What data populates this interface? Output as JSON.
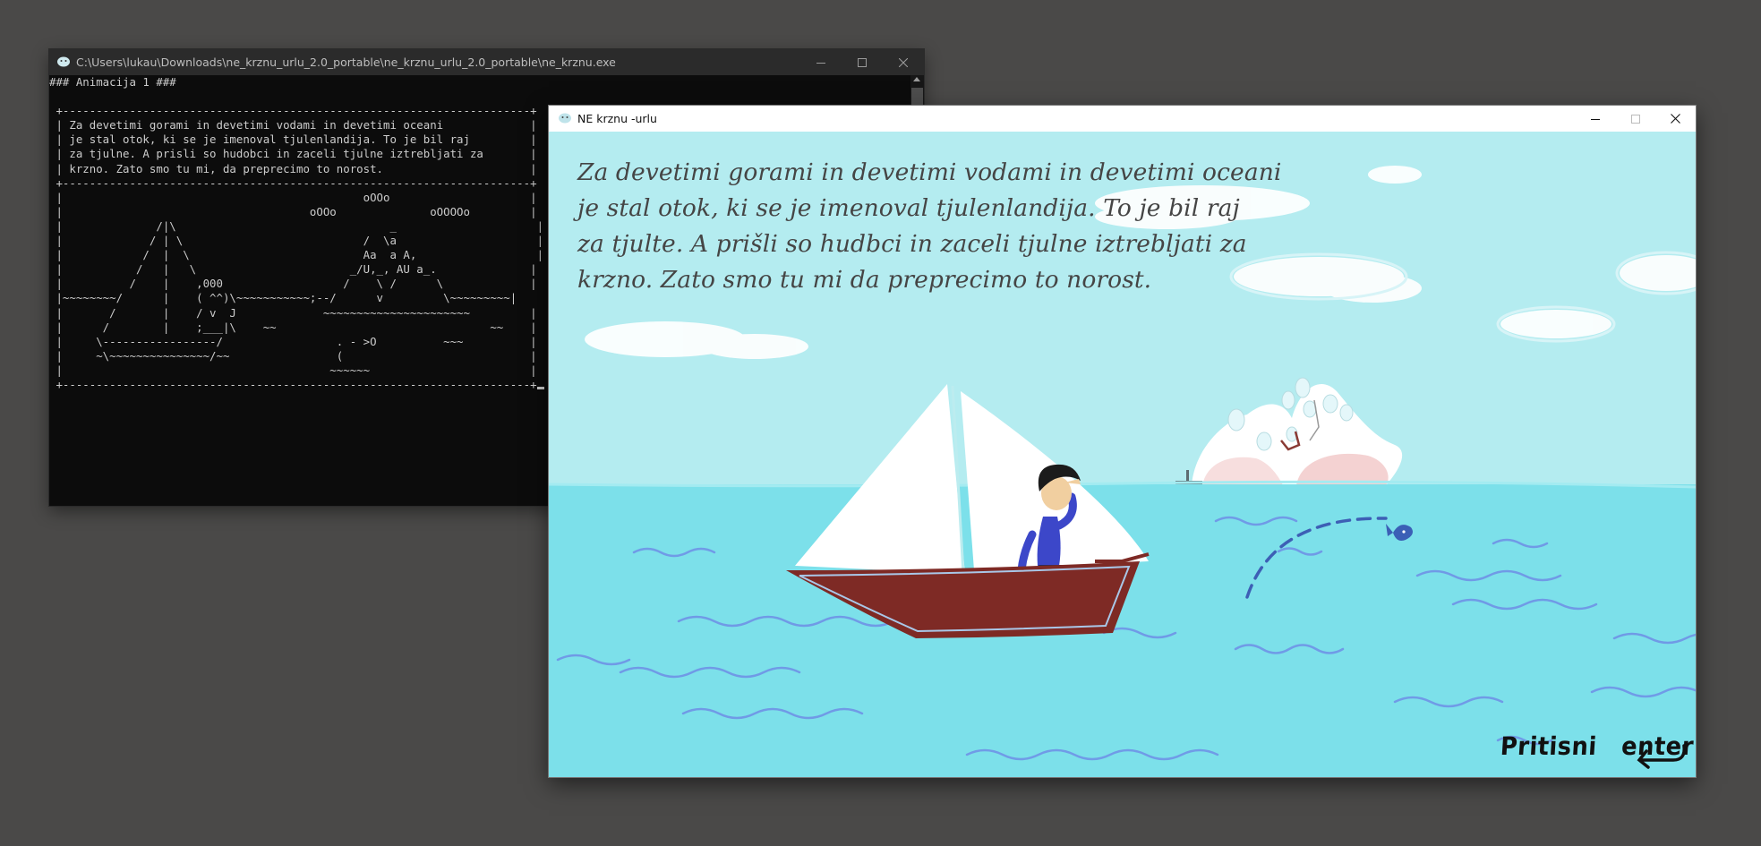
{
  "console": {
    "title": "C:\\Users\\lukau\\Downloads\\ne_krznu_urlu_2.0_portable\\ne_krznu_urlu_2.0_portable\\ne_krznu.exe",
    "lines": [
      "### Animacija 1 ###",
      "",
      " +----------------------------------------------------------------------+",
      " | Za devetimi gorami in devetimi vodami in devetimi oceani             |",
      " | je stal otok, ki se je imenoval tjulenlandija. To je bil raj         |",
      " | za tjulne. A prisli so hudobci in zaceli tjulne iztrebljati za       |",
      " | krzno. Zato smo tu mi, da preprecimo to norost.                      |",
      " +----------------------------------------------------------------------+",
      " |                                             oOOo                     |",
      " |                                     oOOo              oOOOOo         |",
      " |              /|\\                                _                     |",
      " |             / | \\                           /  \\a                     |",
      " |            /  |  \\                          Aa  a A,                  |",
      " |           /   |   \\                       _/U,_, AU a_.              |",
      " |          /    |    ,000                  /    \\ /      \\             |",
      " |~~~~~~~~/      |    ( ^^)\\~~~~~~~~~~~;--/      v         \\~~~~~~~~~|",
      " |       /       |    / v  J             ~~~~~~~~~~~~~~~~~~~~~~         |",
      " |      /        |    ;___|\\    ~~                                ~~    |",
      " |     \\-----------------/                 . - >O          ~~~          |",
      " |     ~\\~~~~~~~~~~~~~~~/~~                (                            |",
      " |                                        ~~~~~~                        |",
      " +----------------------------------------------------------------------+"
    ]
  },
  "game": {
    "title": "NE krznu -urlu",
    "story_lines": [
      "Za devetimi gorami in devetimi vodami in devetimi oceani",
      "je stal otok, ki se je imenoval tjulenlandija. To je bil raj",
      "za tjulte. A prišli so hudbci in zaceli tjulne iztrebljati za",
      "krzno. Zato smo tu mi da preprecimo to norost."
    ],
    "prompt_word1": "Pritisni",
    "prompt_word2": "enter"
  },
  "colors": {
    "desktop": "#4a4948",
    "sky": "#b4ecf0",
    "sea": "#7ce0ea",
    "boat_hull": "#7e2a25",
    "text": "#454545"
  },
  "icons": [
    "app-icon",
    "minimize-icon",
    "maximize-icon",
    "close-icon",
    "enter-arrow-icon"
  ]
}
